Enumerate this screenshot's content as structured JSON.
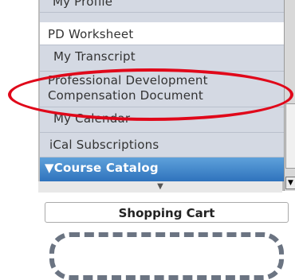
{
  "nav": {
    "items": [
      {
        "label": "My Profile"
      },
      {
        "label": "PD Worksheet"
      },
      {
        "label": "My Transcript"
      },
      {
        "label": "Professional Development Compensation Document"
      },
      {
        "label": "My Calendar"
      },
      {
        "label": "iCal Subscriptions"
      },
      {
        "label": "▼Course Catalog"
      }
    ],
    "collapse_glyph": "▼"
  },
  "cart": {
    "title": "Shopping Cart"
  },
  "colors": {
    "highlight_ellipse": "#e0081a",
    "catalog_blue": "#2f73bd"
  }
}
